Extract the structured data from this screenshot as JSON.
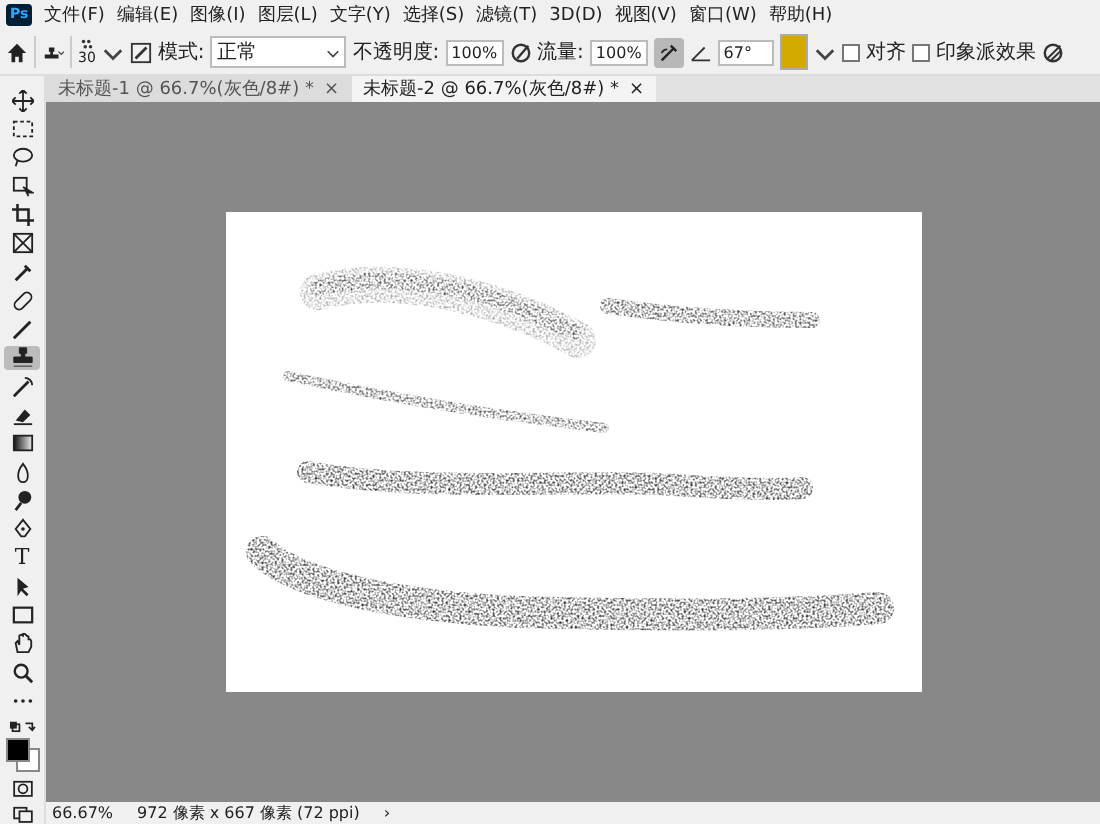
{
  "app_icon": "Ps",
  "menu": [
    "文件(F)",
    "编辑(E)",
    "图像(I)",
    "图层(L)",
    "文字(Y)",
    "选择(S)",
    "滤镜(T)",
    "3D(D)",
    "视图(V)",
    "窗口(W)",
    "帮助(H)"
  ],
  "options": {
    "brush_size": "30",
    "mode_label": "模式:",
    "mode_value": "正常",
    "opacity_label": "不透明度:",
    "opacity_value": "100%",
    "flow_label": "流量:",
    "flow_value": "100%",
    "airbrush_on": true,
    "angle": "67°",
    "aligned": {
      "label": "对齐",
      "checked": false
    },
    "impressionist": {
      "label": "印象派效果",
      "checked": false
    }
  },
  "tabs": [
    {
      "label": "未标题-1 @ 66.7%(灰色/8#) *",
      "close": "×",
      "selected": false
    },
    {
      "label": "未标题-2 @ 66.7%(灰色/8#) *",
      "close": "×",
      "selected": true
    }
  ],
  "tools": [
    {
      "kind": "move",
      "selected": false
    },
    {
      "kind": "marquee",
      "selected": false
    },
    {
      "kind": "lasso",
      "selected": false
    },
    {
      "kind": "object-select",
      "selected": false
    },
    {
      "kind": "crop",
      "selected": false
    },
    {
      "kind": "frame",
      "selected": false
    },
    {
      "kind": "eyedropper",
      "selected": false
    },
    {
      "kind": "healing",
      "selected": false
    },
    {
      "kind": "brush",
      "selected": false
    },
    {
      "kind": "stamp",
      "selected": true
    },
    {
      "kind": "history-brush",
      "selected": false
    },
    {
      "kind": "eraser",
      "selected": false
    },
    {
      "kind": "gradient",
      "selected": false
    },
    {
      "kind": "blur",
      "selected": false
    },
    {
      "kind": "dodge",
      "selected": false
    },
    {
      "kind": "pen",
      "selected": false
    },
    {
      "kind": "type",
      "glyph": "T",
      "selected": false
    },
    {
      "kind": "path-select",
      "selected": false
    },
    {
      "kind": "rectangle",
      "selected": false
    },
    {
      "kind": "hand",
      "selected": false
    },
    {
      "kind": "zoom",
      "selected": false
    },
    {
      "kind": "more",
      "selected": false
    }
  ],
  "status_bar": {
    "zoom": "66.67%",
    "doc_info": "972 像素 x 667 像素 (72 ppi)",
    "arrow": "›"
  }
}
